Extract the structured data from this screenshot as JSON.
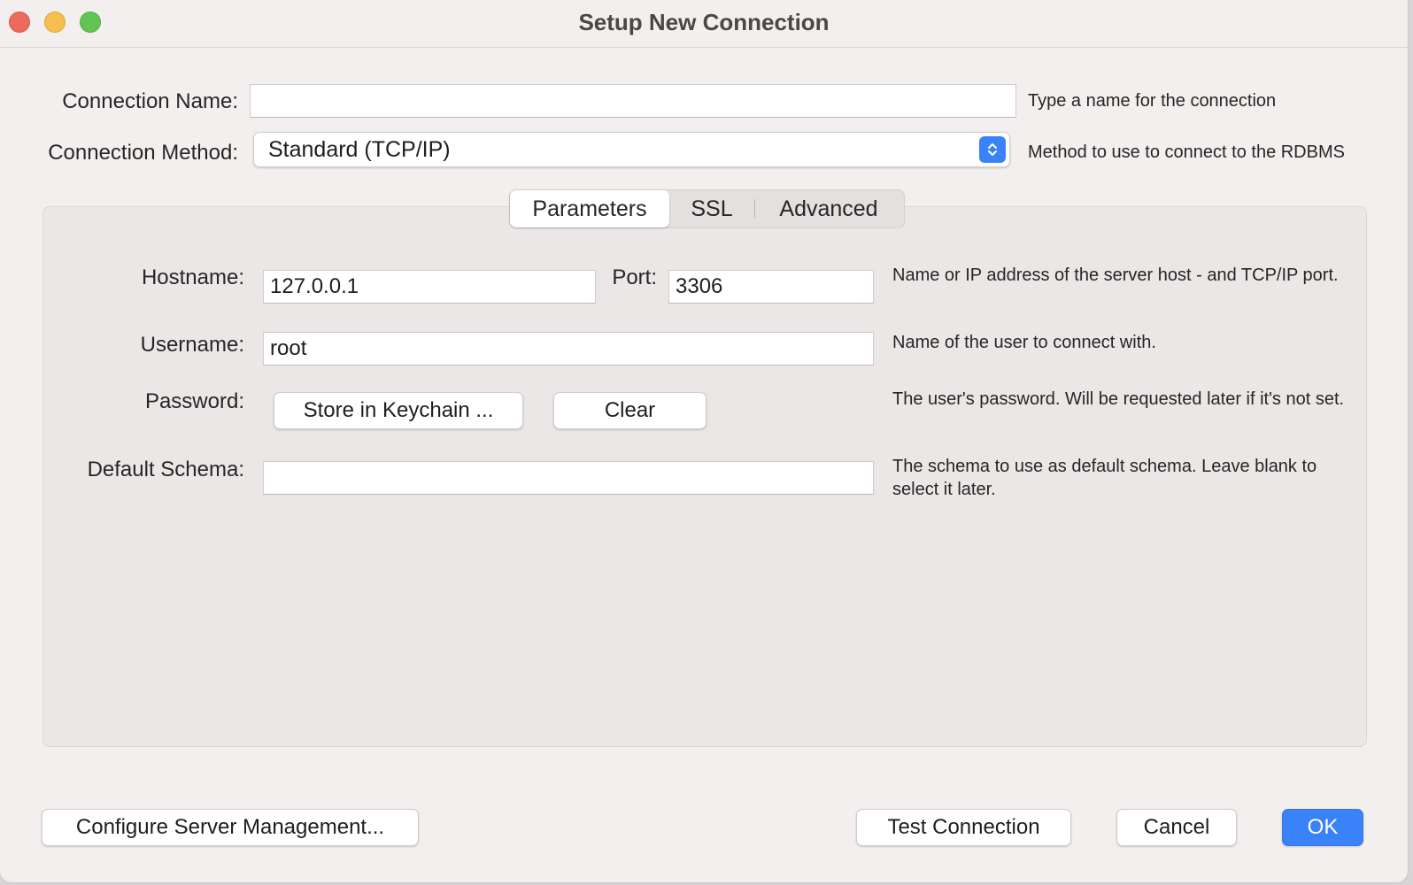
{
  "window": {
    "title": "Setup New Connection"
  },
  "connection_name": {
    "label": "Connection Name:",
    "value": "",
    "hint": "Type a name for the connection"
  },
  "connection_method": {
    "label": "Connection Method:",
    "value": "Standard (TCP/IP)",
    "hint": "Method to use to connect to the RDBMS"
  },
  "tabs": [
    {
      "label": "Parameters",
      "active": true
    },
    {
      "label": "SSL",
      "active": false
    },
    {
      "label": "Advanced",
      "active": false
    }
  ],
  "params": {
    "hostname": {
      "label": "Hostname:",
      "value": "127.0.0.1"
    },
    "port": {
      "label": "Port:",
      "value": "3306"
    },
    "host_hint": "Name or IP address of the server host - and TCP/IP port.",
    "username": {
      "label": "Username:",
      "value": "root",
      "hint": "Name of the user to connect with."
    },
    "password": {
      "label": "Password:",
      "store_button": "Store in Keychain ...",
      "clear_button": "Clear",
      "hint": "The user's password. Will be requested later if it's not set."
    },
    "default_schema": {
      "label": "Default Schema:",
      "value": "",
      "hint": "The schema to use as default schema. Leave blank to select it later."
    }
  },
  "footer": {
    "configure_button": "Configure Server Management...",
    "test_button": "Test Connection",
    "cancel_button": "Cancel",
    "ok_button": "OK"
  },
  "colors": {
    "accent": "#3a82f7",
    "background": "#f3efee",
    "panel": "#ebe7e6"
  }
}
